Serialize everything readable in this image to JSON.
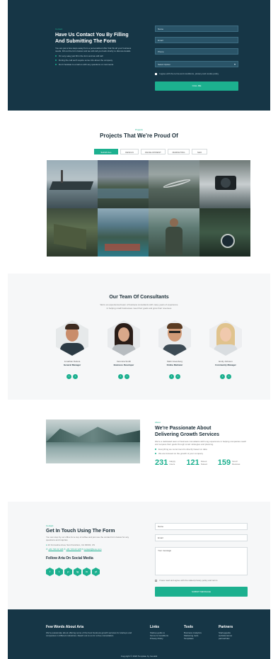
{
  "contact_top": {
    "eyebrow": "Contact",
    "title_line1": "Have Us Contact You By Filling",
    "title_line2": "And Submitting The Form",
    "intro": "You are just a few steps away from a personalized offer that fits all your business needs. Fill out the form below and we will call you back shortly to discuss details.",
    "bullets": [
      "It's very easy just fill in the form and we will call",
      "During the call we'll require some info about the company",
      "Don't hesitate to email us with any questions or comments"
    ],
    "fields": {
      "name": "Name",
      "email": "Email",
      "phone": "Phone",
      "select": "Select Option"
    },
    "checkbox_label": "I agree with the terms and conditions, privacy and cookie policy",
    "submit": "CALL ME"
  },
  "projects": {
    "eyebrow": "Projects",
    "title": "Projects That We're Proud Of",
    "tabs": [
      "SHOW ALL",
      "DESIGN",
      "DEVELOPMENT",
      "MARKETING",
      "SEO"
    ]
  },
  "team": {
    "title": "Our Team Of Consultants",
    "intro_line1": "We're an experienced team of business consultants with many years of experience",
    "intro_line2": "in helping small businesses meet their goals and grow their revenues",
    "members": [
      {
        "name": "Jonathan Deluca",
        "role": "General Manager"
      },
      {
        "name": "Veronica Smith",
        "role": "Business Developer"
      },
      {
        "name": "Mark Greenberg",
        "role": "Online Marketer"
      },
      {
        "name": "Emily Johnson",
        "role": "Community Manager"
      }
    ]
  },
  "about": {
    "eyebrow": "About",
    "title_line1": "We're Passionate About",
    "title_line2": "Delivering Growth Services",
    "text": "We're a dedicated team of business consultants with long experience in helping companies reach and surpass their goals through smart strategies and planning.",
    "bullets": [
      "Everything we recommend is directly based on data",
      "We are focused on the growth of your company"
    ],
    "stats": [
      {
        "value": "231",
        "label": "Happy Users"
      },
      {
        "value": "121",
        "label": "Issues Solved"
      },
      {
        "value": "159",
        "label": "Good Reviews"
      }
    ]
  },
  "contact_bottom": {
    "eyebrow": "Contact",
    "title": "Get In Touch Using The Form",
    "text": "You can stop by our office for a cup of coffee and just use the contact form below for any questions and inquiries",
    "address": "22 Innovative Area, San Francisco, CA 94043, US",
    "phone1": "+81 720 22 126",
    "phone2": "+81 720 22 128",
    "email": "contact@leno.com",
    "social_title": "Follow Aria On Social Media",
    "social": [
      "f",
      "t",
      "p",
      "ig",
      "in",
      "yt"
    ],
    "fields": {
      "name": "Name",
      "email": "Email",
      "message": "Your message"
    },
    "checkbox_label": "I have read and agree with the stated privacy policy and terms",
    "submit": "SUBMIT MESSAGE"
  },
  "footer": {
    "about_title": "Few Words About Aria",
    "about_text": "We're passionate about offering some of the best business growth services for startups and companies in different industries. Reach out to us for a free consultation.",
    "cols": [
      {
        "title": "Links",
        "lines": [
          "Startup guide to",
          "Terms & Conditions",
          "Privacy Policy"
        ]
      },
      {
        "title": "Tools",
        "lines": [
          "Business Analytics",
          "Marketing tools",
          "Templates"
        ]
      },
      {
        "title": "Partners",
        "lines": [
          "Startupguide",
          "websitenames",
          "partnerlinks"
        ]
      }
    ],
    "copyright": "Copyright © 2020 Template by Inovatik"
  },
  "colors": {
    "dark": "#163646",
    "accent": "#1cb08f"
  }
}
